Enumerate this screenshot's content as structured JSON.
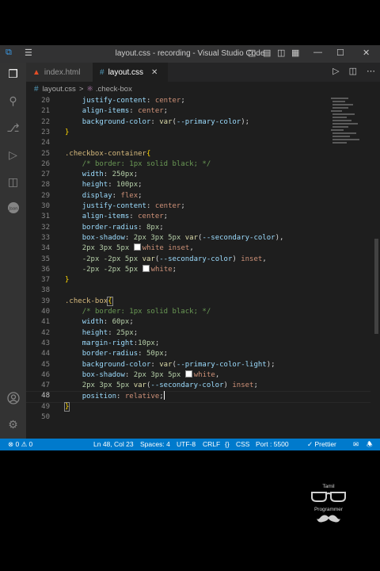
{
  "window": {
    "title": "layout.css - recording - Visual Studio Code",
    "minimize": "—",
    "maximize": "☐",
    "close": "✕"
  },
  "tabs": [
    {
      "label": "index.html",
      "active": false
    },
    {
      "label": "layout.css",
      "active": true,
      "close": "✕"
    }
  ],
  "breadcrumb": {
    "file": "layout.css",
    "separator": ">",
    "symbol": ".check-box"
  },
  "editor": {
    "lines": [
      {
        "n": "20"
      },
      {
        "n": "21"
      },
      {
        "n": "22"
      },
      {
        "n": "23"
      },
      {
        "n": "24"
      },
      {
        "n": "25"
      },
      {
        "n": "26"
      },
      {
        "n": "27"
      },
      {
        "n": "28"
      },
      {
        "n": "29"
      },
      {
        "n": "30"
      },
      {
        "n": "31"
      },
      {
        "n": "32"
      },
      {
        "n": "33"
      },
      {
        "n": "34"
      },
      {
        "n": "35"
      },
      {
        "n": "36"
      },
      {
        "n": "37"
      },
      {
        "n": "38"
      },
      {
        "n": "39"
      },
      {
        "n": "40"
      },
      {
        "n": "41"
      },
      {
        "n": "42"
      },
      {
        "n": "43"
      },
      {
        "n": "44"
      },
      {
        "n": "45"
      },
      {
        "n": "46"
      },
      {
        "n": "47"
      },
      {
        "n": "48"
      },
      {
        "n": "49"
      },
      {
        "n": "50"
      }
    ],
    "current_line": "48"
  },
  "status": {
    "problems": "⊗ 0 ⚠ 0",
    "position": "Ln 48, Col 23",
    "spaces": "Spaces: 4",
    "encoding": "UTF-8",
    "eol": "CRLF",
    "language": "CSS",
    "port": "Port : 5500",
    "prettier": "✓ Prettier"
  },
  "watermark": {
    "line1": "Tamil",
    "line2": "Programmer"
  },
  "colors": {
    "accent": "#007acc",
    "background": "#1e1e1e"
  }
}
